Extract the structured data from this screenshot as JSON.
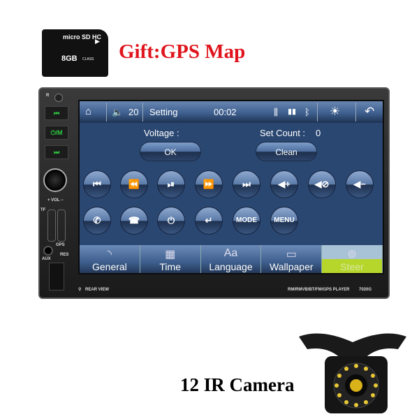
{
  "sd_card": {
    "brand": "micro SD HC",
    "capacity": "8GB",
    "class": "CLASS"
  },
  "gift_text": "Gift:GPS Map",
  "screen": {
    "topbar": {
      "volume": "20",
      "title": "Setting",
      "time": "00:02",
      "icons": [
        "home-icon",
        "volume-icon",
        "equalizer-icon",
        "sd-icon",
        "usb-icon",
        "bluetooth-icon",
        "brightness-icon",
        "back-icon"
      ]
    },
    "voltage_label": "Voltage :",
    "set_count_label": "Set Count :",
    "set_count_value": "0",
    "ok_label": "OK",
    "clean_label": "Clean",
    "row1": [
      "⏮",
      "⏪",
      "⏯",
      "⏩",
      "⏭",
      "◀+",
      "◀⊘",
      "◀−"
    ],
    "row2": [
      "✆",
      "☎",
      "⏻",
      "↵",
      "MODE",
      "MENU"
    ],
    "tabs": [
      {
        "label": "General",
        "icon": "rss-icon"
      },
      {
        "label": "Time",
        "icon": "calendar-icon"
      },
      {
        "label": "Language",
        "icon": "font-icon"
      },
      {
        "label": "Wallpaper",
        "icon": "image-icon"
      },
      {
        "label": "Steer",
        "icon": "steering-wheel-icon"
      }
    ],
    "active_tab": "Steer",
    "active_color": "#b6d62c"
  },
  "unit": {
    "prev": "⏮",
    "mode": "⏻/M",
    "next": "⏭",
    "vol": "+ VOL −",
    "tf": "TF",
    "gps": "GPS",
    "aux": "AUX",
    "res": "RES",
    "r": "R",
    "rear_view": "REAR VIEW",
    "player": "RM/RMVB/BT/FM/GPS PLAYER",
    "model": "7020G"
  },
  "camera_text": "12 IR Camera"
}
